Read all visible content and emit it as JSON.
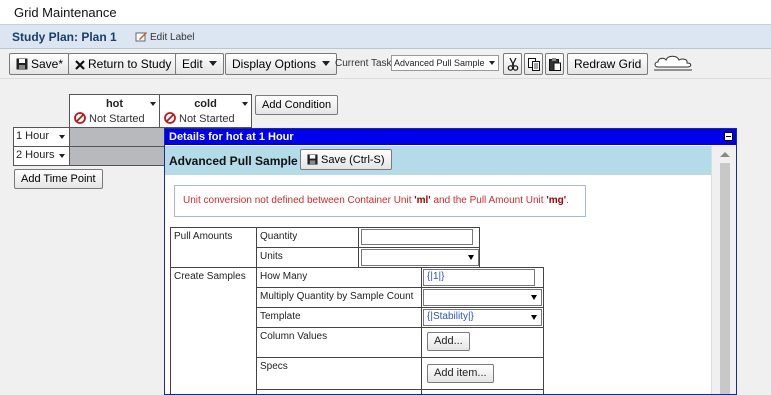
{
  "window": {
    "title": "Grid Maintenance"
  },
  "planbar": {
    "title": "Study Plan: Plan 1",
    "edit_label": "Edit Label"
  },
  "toolbar": {
    "save_label": "Save*",
    "return_label": "Return to Study",
    "edit_label": "Edit",
    "display_options_label": "Display Options",
    "current_task_label": "Current Task:",
    "current_task_value": "Advanced Pull Sample",
    "redraw_label": "Redraw Grid"
  },
  "grid": {
    "columns": [
      {
        "name": "hot",
        "status": "Not Started"
      },
      {
        "name": "cold",
        "status": "Not Started"
      }
    ],
    "rows": [
      {
        "label": "1 Hour"
      },
      {
        "label": "2 Hours"
      }
    ],
    "add_condition_label": "Add Condition",
    "add_timepoint_label": "Add Time Point"
  },
  "details": {
    "header": "Details for hot at 1 Hour",
    "task_title": "Advanced Pull Sample",
    "save_label": "Save (Ctrl-S)",
    "warning_prefix": "Unit conversion not defined between Container Unit ",
    "warning_container_unit": "'ml'",
    "warning_middle": " and the Pull Amount Unit ",
    "warning_pull_unit": "'mg'",
    "warning_suffix": ".",
    "sections": {
      "pull_amounts": "Pull Amounts",
      "create_samples": "Create Samples"
    },
    "fields": {
      "quantity": {
        "label": "Quantity",
        "value": ""
      },
      "units": {
        "label": "Units",
        "value": ""
      },
      "how_many": {
        "label": "How Many",
        "value": "{|1|}"
      },
      "multiply": {
        "label": "Multiply Quantity by Sample Count",
        "value": ""
      },
      "template": {
        "label": "Template",
        "value": "{|Stability|}"
      },
      "column_values": {
        "label": "Column Values",
        "button": "Add..."
      },
      "specs": {
        "label": "Specs",
        "button": "Add item..."
      }
    }
  },
  "colors": {
    "panel_header": "#0000ee",
    "sub_header": "#b3dbe8",
    "warning": "#d42a2a"
  }
}
